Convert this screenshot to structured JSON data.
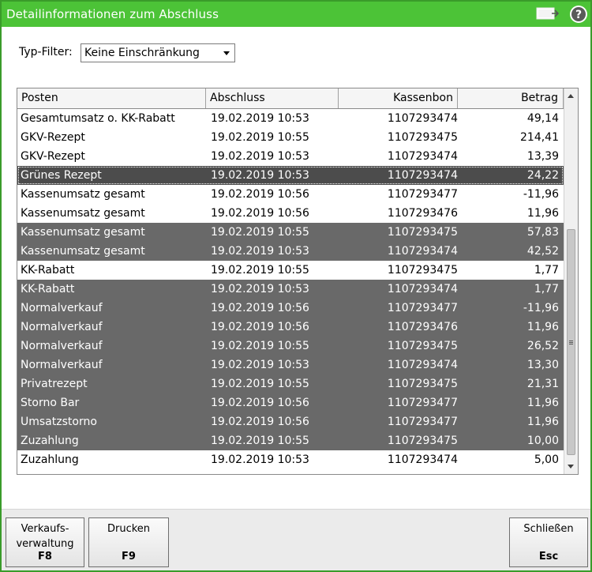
{
  "window": {
    "title": "Detailinformationen zum Abschluss"
  },
  "filter": {
    "label": "Typ-Filter:",
    "value": "Keine Einschränkung"
  },
  "table": {
    "columns": [
      "Posten",
      "Abschluss",
      "Kassenbon",
      "Betrag"
    ],
    "rows": [
      {
        "posten": "Gesamtumsatz o. KK-Rabatt",
        "abschluss": "19.02.2019 10:53",
        "kassenbon": "1107293474",
        "betrag": "49,14",
        "style": "normal"
      },
      {
        "posten": "GKV-Rezept",
        "abschluss": "19.02.2019 10:55",
        "kassenbon": "1107293475",
        "betrag": "214,41",
        "style": "normal"
      },
      {
        "posten": "GKV-Rezept",
        "abschluss": "19.02.2019 10:53",
        "kassenbon": "1107293474",
        "betrag": "13,39",
        "style": "normal"
      },
      {
        "posten": "Grünes Rezept",
        "abschluss": "19.02.2019 10:53",
        "kassenbon": "1107293474",
        "betrag": "24,22",
        "style": "focused"
      },
      {
        "posten": "Kassenumsatz gesamt",
        "abschluss": "19.02.2019 10:56",
        "kassenbon": "1107293477",
        "betrag": "-11,96",
        "style": "normal"
      },
      {
        "posten": "Kassenumsatz gesamt",
        "abschluss": "19.02.2019 10:56",
        "kassenbon": "1107293476",
        "betrag": "11,96",
        "style": "normal"
      },
      {
        "posten": "Kassenumsatz gesamt",
        "abschluss": "19.02.2019 10:55",
        "kassenbon": "1107293475",
        "betrag": "57,83",
        "style": "dark"
      },
      {
        "posten": "Kassenumsatz gesamt",
        "abschluss": "19.02.2019 10:53",
        "kassenbon": "1107293474",
        "betrag": "42,52",
        "style": "dark"
      },
      {
        "posten": "KK-Rabatt",
        "abschluss": "19.02.2019 10:55",
        "kassenbon": "1107293475",
        "betrag": "1,77",
        "style": "normal"
      },
      {
        "posten": "KK-Rabatt",
        "abschluss": "19.02.2019 10:53",
        "kassenbon": "1107293474",
        "betrag": "1,77",
        "style": "dark"
      },
      {
        "posten": "Normalverkauf",
        "abschluss": "19.02.2019 10:56",
        "kassenbon": "1107293477",
        "betrag": "-11,96",
        "style": "dark"
      },
      {
        "posten": "Normalverkauf",
        "abschluss": "19.02.2019 10:56",
        "kassenbon": "1107293476",
        "betrag": "11,96",
        "style": "dark"
      },
      {
        "posten": "Normalverkauf",
        "abschluss": "19.02.2019 10:55",
        "kassenbon": "1107293475",
        "betrag": "26,52",
        "style": "dark"
      },
      {
        "posten": "Normalverkauf",
        "abschluss": "19.02.2019 10:53",
        "kassenbon": "1107293474",
        "betrag": "13,30",
        "style": "dark"
      },
      {
        "posten": "Privatrezept",
        "abschluss": "19.02.2019 10:55",
        "kassenbon": "1107293475",
        "betrag": "21,31",
        "style": "dark"
      },
      {
        "posten": "Storno Bar",
        "abschluss": "19.02.2019 10:56",
        "kassenbon": "1107293477",
        "betrag": "11,96",
        "style": "dark"
      },
      {
        "posten": "Umsatzstorno",
        "abschluss": "19.02.2019 10:56",
        "kassenbon": "1107293477",
        "betrag": "11,96",
        "style": "dark"
      },
      {
        "posten": "Zuzahlung",
        "abschluss": "19.02.2019 10:55",
        "kassenbon": "1107293475",
        "betrag": "10,00",
        "style": "dark"
      },
      {
        "posten": "Zuzahlung",
        "abschluss": "19.02.2019 10:53",
        "kassenbon": "1107293474",
        "betrag": "5,00",
        "style": "normal"
      }
    ]
  },
  "footer": {
    "buttons": [
      {
        "label": "Verkaufs-\nverwaltung",
        "key": "F8"
      },
      {
        "label": "Drucken",
        "key": "F9"
      },
      {
        "label": "Schließen",
        "key": "Esc"
      }
    ]
  },
  "icons": {
    "title_left": "screen-icon",
    "title_right": "help-icon"
  },
  "colors": {
    "titlebar": "#4cc337",
    "selected_row": "#696969",
    "focused_row": "#4c4c4c"
  }
}
